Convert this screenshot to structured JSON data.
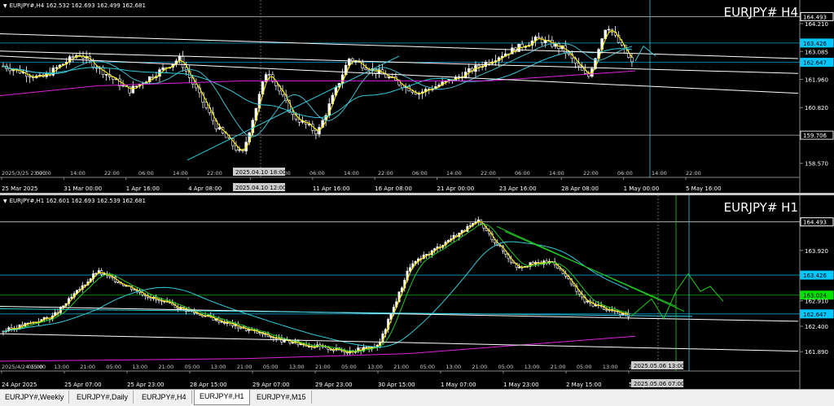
{
  "h4": {
    "header": "EURJPY#,H4  162.532 162.693 162.499 162.681",
    "big_title": "EURJPY# H4",
    "price_labels": [
      {
        "text": "164.493",
        "value": 164.493,
        "box": true,
        "color": "#ffffff"
      },
      {
        "text": "164.210",
        "value": 164.21,
        "box": false
      },
      {
        "text": "163.426",
        "value": 163.426,
        "box": true,
        "color": "#00c8ff"
      },
      {
        "text": "163.085",
        "value": 163.085,
        "box": false
      },
      {
        "text": "162.647",
        "value": 162.647,
        "box": true,
        "color": "#00c8ff"
      },
      {
        "text": "161.960",
        "value": 161.96,
        "box": false
      },
      {
        "text": "160.820",
        "value": 160.82,
        "box": false
      },
      {
        "text": "159.706",
        "value": 159.706,
        "box": true,
        "color": "#e0e0e0"
      },
      {
        "text": "158.570",
        "value": 158.57,
        "box": false
      }
    ],
    "time_labels": [
      "25 Mar 2025",
      "31 Mar 00:00",
      "1 Apr 16:00",
      "4 Apr 08:00",
      "9",
      "11 Apr 16:00",
      "16 Apr 08:00",
      "21 Apr 00:00",
      "23 Apr 16:00",
      "28 Apr 08:00",
      "1 May 00:00",
      "5 May 16:00"
    ],
    "inner_time_labels": [
      "2025/3/25 23:00",
      "07:00",
      "14:00",
      "22:00",
      "06:00",
      "14:00",
      "22:00",
      "06:00",
      "22:00",
      "06:00",
      "14:00",
      "22:00",
      "06:00",
      "14:00",
      "22:00",
      "06:00",
      "14:00",
      "22:00",
      "06:00",
      "14:00",
      "22:00"
    ],
    "crosshair_top": "2025.04.10 18:00",
    "crosshair_bottom": "2025.04.10 12:00"
  },
  "h1": {
    "header": "EURJPY#,H1  162.601 162.693 162.539 162.681",
    "big_title": "EURJPY# H1",
    "price_labels": [
      {
        "text": "164.493",
        "value": 164.493,
        "box": true,
        "color": "#ffffff"
      },
      {
        "text": "163.920",
        "value": 163.92,
        "box": false
      },
      {
        "text": "163.426",
        "value": 163.426,
        "box": true,
        "color": "#00c8ff"
      },
      {
        "text": "163.024",
        "value": 163.024,
        "box": true,
        "color": "#00e000"
      },
      {
        "text": "162.910",
        "value": 162.91,
        "box": false
      },
      {
        "text": "162.647",
        "value": 162.647,
        "box": true,
        "color": "#00c8ff"
      },
      {
        "text": "162.400",
        "value": 162.4,
        "box": false
      },
      {
        "text": "161.890",
        "value": 161.89,
        "box": false
      }
    ],
    "time_labels": [
      "24 Apr 2025",
      "25 Apr 07:00",
      "25 Apr 23:00",
      "28 Apr 15:00",
      "29 Apr 07:00",
      "29 Apr 23:00",
      "30 Apr 15:00",
      "1 May 07:00",
      "1 May 23:00",
      "2 May 15:00",
      "5 May 07:00"
    ],
    "inner_time_labels": [
      "2025/4/24 15:00",
      "05:00",
      "13:00",
      "21:00",
      "05:00",
      "13:00",
      "21:00",
      "05:00",
      "13:00",
      "21:00",
      "05:00",
      "13:00",
      "21:00",
      "05:00",
      "13:00",
      "21:00",
      "05:00",
      "13:00",
      "21:00",
      "05:00",
      "13:00",
      "21:00",
      "05:00",
      "13:00",
      "21:00"
    ],
    "crosshair_top": "2025.05.06 13:00",
    "crosshair_bottom": "2025.05.06 07:00"
  },
  "tabs": [
    {
      "label": "EURJPY#,Weekly",
      "active": false
    },
    {
      "label": "EURJPY#,Daily",
      "active": false
    },
    {
      "label": "EURJPY#,H4",
      "active": false
    },
    {
      "label": "EURJPY#,H1",
      "active": true
    },
    {
      "label": "EURJPY#,M15",
      "active": false
    }
  ],
  "colors": {
    "candle": "#ffffff",
    "ma_cyan": "#33ccdd",
    "ma_magenta": "#dd22dd",
    "zigzag": "#ffee00",
    "ma_green": "#22cc22",
    "trend": "#ffffff",
    "sr_cyan": "#00c8ff",
    "sr_green": "#00e000"
  }
}
